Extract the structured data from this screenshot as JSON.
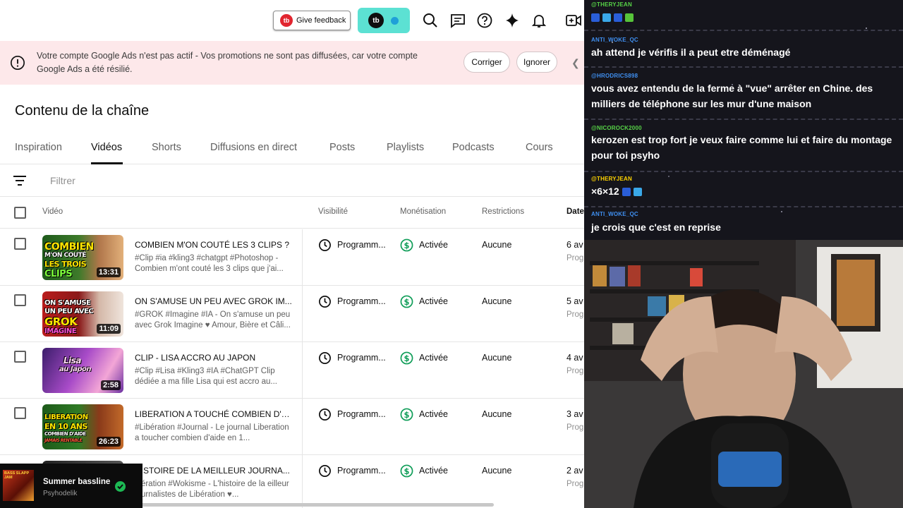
{
  "topbar": {
    "feedback_label": "Give feedback",
    "feedback_logo": "tb",
    "pill_logo": "tb",
    "icons": [
      "search-icon",
      "feedback-icon",
      "help-icon",
      "sparkle-icon",
      "bell-icon",
      "create-video-icon"
    ]
  },
  "banner": {
    "message": "Votre compte Google Ads n'est pas actif - Vos promotions ne sont pas diffusées, car votre compte Google Ads a été résilié.",
    "fix_label": "Corriger",
    "ignore_label": "Ignorer",
    "background": "#fde8ea"
  },
  "page": {
    "title": "Contenu de la chaîne",
    "tabs": [
      "Inspiration",
      "Vidéos",
      "Shorts",
      "Diffusions en direct",
      "Posts",
      "Playlists",
      "Podcasts",
      "Cours"
    ],
    "active_tab": "Vidéos"
  },
  "filter": {
    "placeholder": "Filtrer"
  },
  "table": {
    "headers": {
      "video": "Vidéo",
      "visibility": "Visibilité",
      "monetization": "Monétisation",
      "restrictions": "Restrictions",
      "date": "Date"
    },
    "rows": [
      {
        "thumb_text": [
          "COMBIEN",
          "M'ON COUTÉ",
          "LES TROIS",
          "CLIPS"
        ],
        "duration": "13:31",
        "title": "COMBIEN M'ON COUTÉ LES 3 CLIPS ?",
        "description": "#Clip #ia #kling3 #chatgpt #Photoshop - Combien m'ont couté les 3 clips que j'ai...",
        "visibility": "Programm...",
        "monetization": "Activée",
        "restrictions": "Aucune",
        "date": "6 av",
        "date_sub": "Prog"
      },
      {
        "thumb_text": [
          "ON S'AMUSE",
          "UN PEU AVEC",
          "GROK",
          "IMAGINE"
        ],
        "duration": "11:09",
        "title": "ON S'AMUSE UN PEU AVEC GROK IM...",
        "description": "#GROK #Imagine #IA - On s'amuse un peu avec Grok Imagine ♥ Amour, Bière et Câli...",
        "visibility": "Programm...",
        "monetization": "Activée",
        "restrictions": "Aucune",
        "date": "5 av",
        "date_sub": "Prog"
      },
      {
        "thumb_text": [
          "Lisa",
          "au Japon"
        ],
        "duration": "2:58",
        "title": "CLIP - LISA ACCRO AU JAPON",
        "description": "#Clip #Lisa #Kling3 #IA #ChatGPT Clip dédiée a ma fille Lisa qui est accro au...",
        "visibility": "Programm...",
        "monetization": "Activée",
        "restrictions": "Aucune",
        "date": "4 av",
        "date_sub": "Prog"
      },
      {
        "thumb_text": [
          "LIBERATION",
          "EN 10 ANS",
          "COMBIEN D'AIDE",
          "JAMAIS RENTABLE"
        ],
        "duration": "26:23",
        "title": "LIBERATION A TOUCHÉ COMBIEN D'A...",
        "description": "#Libération #Journal - Le journal Liberation a toucher combien d'aide en 1...",
        "visibility": "Programm...",
        "monetization": "Activée",
        "restrictions": "Aucune",
        "date": "3 av",
        "date_sub": "Prog"
      },
      {
        "thumb_text": [],
        "duration": "",
        "title": "HISTOIRE DE LA MEILLEUR JOURNA...",
        "description": "ibération #Wokisme - L'histoire de la eilleur journalistes de Libération ♥...",
        "visibility": "Programm...",
        "monetization": "Activée",
        "restrictions": "Aucune",
        "date": "2 av",
        "date_sub": "Prog"
      }
    ]
  },
  "music": {
    "track": "Summer bassline",
    "artist": "Psyhodelik",
    "album_text": "BASS SLAPP JAM",
    "status_icon": "check-circle-icon"
  },
  "chat": {
    "messages": [
      {
        "user": "@THERYJEAN",
        "user_color": "#57d447",
        "text": ""
      },
      {
        "user": "ANTI_WOKE_QC",
        "user_color": "#3f8ff0",
        "text": "ah attend je vérifis il a peut etre déménagé"
      },
      {
        "user": "@HRODRICS898",
        "user_color": "#3f8ff0",
        "text": "vous avez entendu de la ferme à \"vue\" arrêter en Chine. des milliers de téléphone sur les mur d'une maison"
      },
      {
        "user": "@NICOROCK2000",
        "user_color": "#57d447",
        "text": "kerozen est trop fort je veux faire comme lui et faire du montage pour toi psyho"
      },
      {
        "user": "@THERYJEAN",
        "user_color": "#ffd400",
        "text": "×6×12"
      },
      {
        "user": "ANTI_WOKE_QC",
        "user_color": "#3f8ff0",
        "text": "je crois que c'est en reprise"
      }
    ]
  },
  "webcam": {
    "name": "streamer-webcam"
  }
}
